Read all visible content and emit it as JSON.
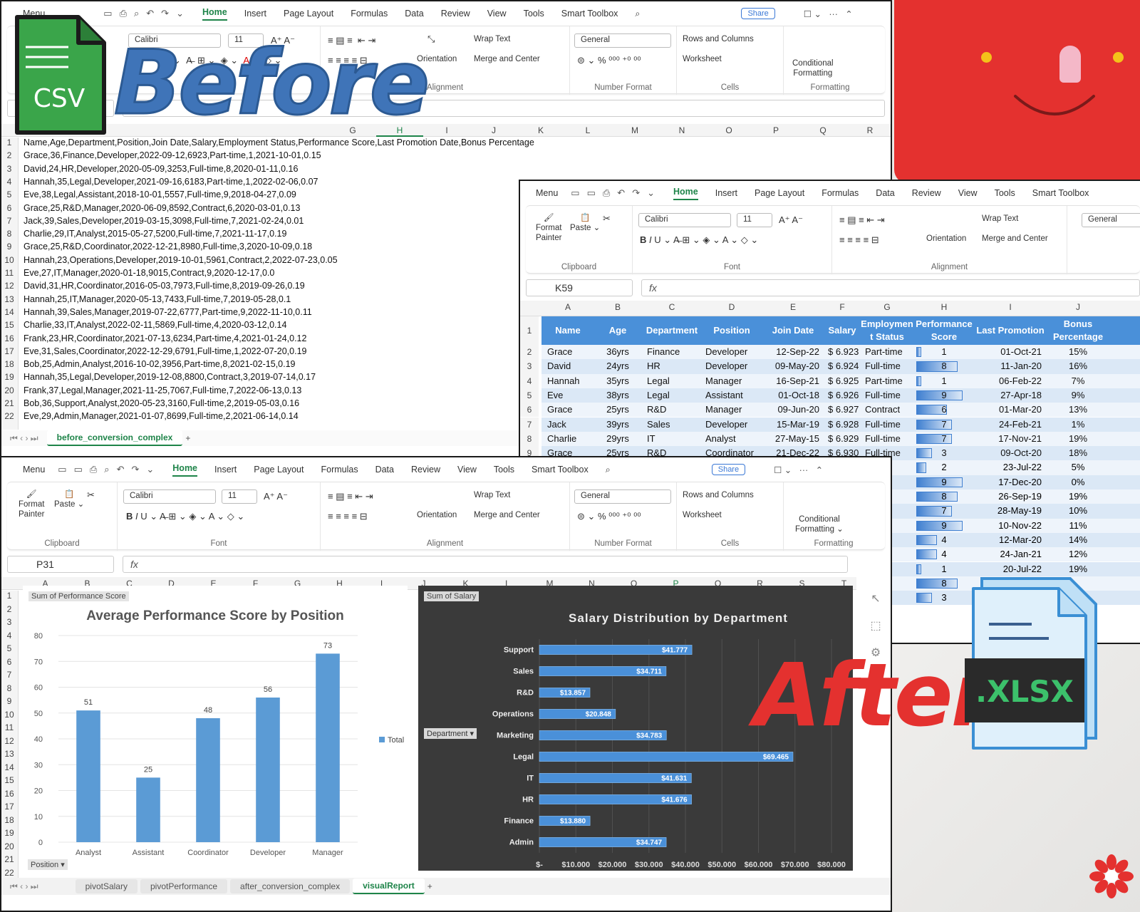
{
  "overlay": {
    "before": "Before",
    "after": "After",
    "csv_badge": "CSV",
    "xlsx_badge": ".XLSX"
  },
  "ribbon": {
    "menu": "Menu",
    "tabs": [
      "Home",
      "Insert",
      "Page Layout",
      "Formulas",
      "Data",
      "Review",
      "View",
      "Tools",
      "Smart Toolbox"
    ],
    "share": "Share",
    "font": "Calibri",
    "size": "11",
    "wrap_text": "Wrap Text",
    "orientation": "Orientation",
    "merge": "Merge and Center",
    "number_format": "General",
    "rows_cols": "Rows and Columns",
    "worksheet": "Worksheet",
    "conditional": "Conditional",
    "formatting": "Formatting",
    "format_painter": "Format",
    "painter": "Painter",
    "paste": "Paste",
    "groups": {
      "clipboard": "Clipboard",
      "font": "Font",
      "alignment": "Alignment",
      "number_format": "Number Format",
      "cells": "Cells",
      "formatting": "Formatting"
    },
    "fx": "fx"
  },
  "csv_window": {
    "columns": [
      "G",
      "H",
      "I",
      "J",
      "K",
      "L",
      "M",
      "N",
      "O",
      "P",
      "Q",
      "R"
    ],
    "rows": [
      "Name,Age,Department,Position,Join Date,Salary,Employment Status,Performance Score,Last Promotion Date,Bonus Percentage",
      "Grace,36,Finance,Developer,2022-09-12,6923,Part-time,1,2021-10-01,0.15",
      "David,24,HR,Developer,2020-05-09,3253,Full-time,8,2020-01-11,0.16",
      "Hannah,35,Legal,Developer,2021-09-16,6183,Part-time,1,2022-02-06,0.07",
      "Eve,38,Legal,Assistant,2018-10-01,5557,Full-time,9,2018-04-27,0.09",
      "Grace,25,R&D,Manager,2020-06-09,8592,Contract,6,2020-03-01,0.13",
      "Jack,39,Sales,Developer,2019-03-15,3098,Full-time,7,2021-02-24,0.01",
      "Charlie,29,IT,Analyst,2015-05-27,5200,Full-time,7,2021-11-17,0.19",
      "Grace,25,R&D,Coordinator,2022-12-21,8980,Full-time,3,2020-10-09,0.18",
      "Hannah,23,Operations,Developer,2019-10-01,5961,Contract,2,2022-07-23,0.05",
      "Eve,27,IT,Manager,2020-01-18,9015,Contract,9,2020-12-17,0.0",
      "David,31,HR,Coordinator,2016-05-03,7973,Full-time,8,2019-09-26,0.19",
      "Hannah,25,IT,Manager,2020-05-13,7433,Full-time,7,2019-05-28,0.1",
      "Hannah,39,Sales,Manager,2019-07-22,6777,Part-time,9,2022-11-10,0.11",
      "Charlie,33,IT,Analyst,2022-02-11,5869,Full-time,4,2020-03-12,0.14",
      "Frank,23,HR,Coordinator,2021-07-13,6234,Part-time,4,2021-01-24,0.12",
      "Eve,31,Sales,Coordinator,2022-12-29,6791,Full-time,1,2022-07-20,0.19",
      "Bob,25,Admin,Analyst,2016-10-02,3956,Part-time,8,2021-02-15,0.19",
      "Hannah,35,Legal,Developer,2019-12-08,8800,Contract,3,2019-07-14,0.17",
      "Frank,37,Legal,Manager,2021-11-25,7067,Full-time,7,2022-06-13,0.13",
      "Bob,36,Support,Analyst,2020-05-23,3160,Full-time,2,2019-05-03,0.16",
      "Eve,29,Admin,Manager,2021-01-07,8699,Full-time,2,2021-06-14,0.14"
    ],
    "sheet_tab": "before_conversion_complex"
  },
  "xlsx_window": {
    "cell_ref": "K59",
    "columns": [
      "A",
      "B",
      "C",
      "D",
      "E",
      "F",
      "G",
      "H",
      "I",
      "J"
    ],
    "headers": [
      "Name",
      "Age",
      "Department",
      "Position",
      "Join Date",
      "Salary",
      "Employmen t Status",
      "Performance Score",
      "Last Promotion",
      "Bonus Percentage"
    ],
    "rows": [
      [
        "Grace",
        "36yrs",
        "Finance",
        "Developer",
        "12-Sep-22",
        "$ 6.923",
        "Part-time",
        "1",
        "01-Oct-21",
        "15%"
      ],
      [
        "David",
        "24yrs",
        "HR",
        "Developer",
        "09-May-20",
        "$ 6.924",
        "Full-time",
        "8",
        "11-Jan-20",
        "16%"
      ],
      [
        "Hannah",
        "35yrs",
        "Legal",
        "Manager",
        "16-Sep-21",
        "$ 6.925",
        "Part-time",
        "1",
        "06-Feb-22",
        "7%"
      ],
      [
        "Eve",
        "38yrs",
        "Legal",
        "Assistant",
        "01-Oct-18",
        "$ 6.926",
        "Full-time",
        "9",
        "27-Apr-18",
        "9%"
      ],
      [
        "Grace",
        "25yrs",
        "R&D",
        "Manager",
        "09-Jun-20",
        "$ 6.927",
        "Contract",
        "6",
        "01-Mar-20",
        "13%"
      ],
      [
        "Jack",
        "39yrs",
        "Sales",
        "Developer",
        "15-Mar-19",
        "$ 6.928",
        "Full-time",
        "7",
        "24-Feb-21",
        "1%"
      ],
      [
        "Charlie",
        "29yrs",
        "IT",
        "Analyst",
        "27-May-15",
        "$ 6.929",
        "Full-time",
        "7",
        "17-Nov-21",
        "19%"
      ],
      [
        "Grace",
        "25yrs",
        "R&D",
        "Coordinator",
        "21-Dec-22",
        "$ 6.930",
        "Full-time",
        "3",
        "09-Oct-20",
        "18%"
      ]
    ],
    "extra_scores": [
      "2",
      "9",
      "8",
      "7",
      "9",
      "4",
      "4",
      "1",
      "8",
      "3"
    ],
    "extra_dates": [
      "23-Jul-22",
      "17-Dec-20",
      "26-Sep-19",
      "28-May-19",
      "10-Nov-22",
      "12-Mar-20",
      "24-Jan-21",
      "20-Jul-22"
    ],
    "extra_bonus": [
      "5%",
      "0%",
      "19%",
      "10%",
      "11%",
      "14%",
      "12%",
      "19%"
    ]
  },
  "report_window": {
    "cell_ref": "P31",
    "columns": [
      "A",
      "B",
      "C",
      "D",
      "E",
      "F",
      "G",
      "H",
      "I",
      "J",
      "K",
      "L",
      "M",
      "N",
      "O",
      "P",
      "Q",
      "R",
      "S",
      "T"
    ],
    "sheet_tabs": [
      "pivotSalary",
      "pivotPerformance",
      "after_conversion_complex",
      "visualReport"
    ],
    "position_filter": "Position",
    "department_filter": "Department"
  },
  "chart_data": [
    {
      "type": "bar",
      "title": "Average Performance Score by Position",
      "field_button": "Sum of Performance Score",
      "categories": [
        "Analyst",
        "Assistant",
        "Coordinator",
        "Developer",
        "Manager"
      ],
      "values": [
        51,
        25,
        48,
        56,
        73
      ],
      "ylim": [
        0,
        80
      ],
      "yticks": [
        0,
        10,
        20,
        30,
        40,
        50,
        60,
        70,
        80
      ],
      "legend": "Total",
      "color": "#5b9bd5"
    },
    {
      "type": "bar",
      "orientation": "horizontal",
      "title": "Salary Distribution by Department",
      "field_button": "Sum of Salary",
      "categories": [
        "Support",
        "Sales",
        "R&D",
        "Operations",
        "Marketing",
        "Legal",
        "IT",
        "HR",
        "Finance",
        "Admin"
      ],
      "values": [
        41777,
        34711,
        13857,
        20848,
        34783,
        69465,
        41631,
        41676,
        13880,
        34747
      ],
      "labels": [
        "$41.777",
        "$34.711",
        "$13.857",
        "$20.848",
        "$34.783",
        "$69.465",
        "$41.631",
        "$41.676",
        "$13.880",
        "$34.747"
      ],
      "xlim": [
        0,
        80000
      ],
      "xticks": [
        "$-",
        "$10.000",
        "$20.000",
        "$30.000",
        "$40.000",
        "$50.000",
        "$60.000",
        "$70.000",
        "$80.000"
      ],
      "color": "#4a90d9"
    }
  ]
}
